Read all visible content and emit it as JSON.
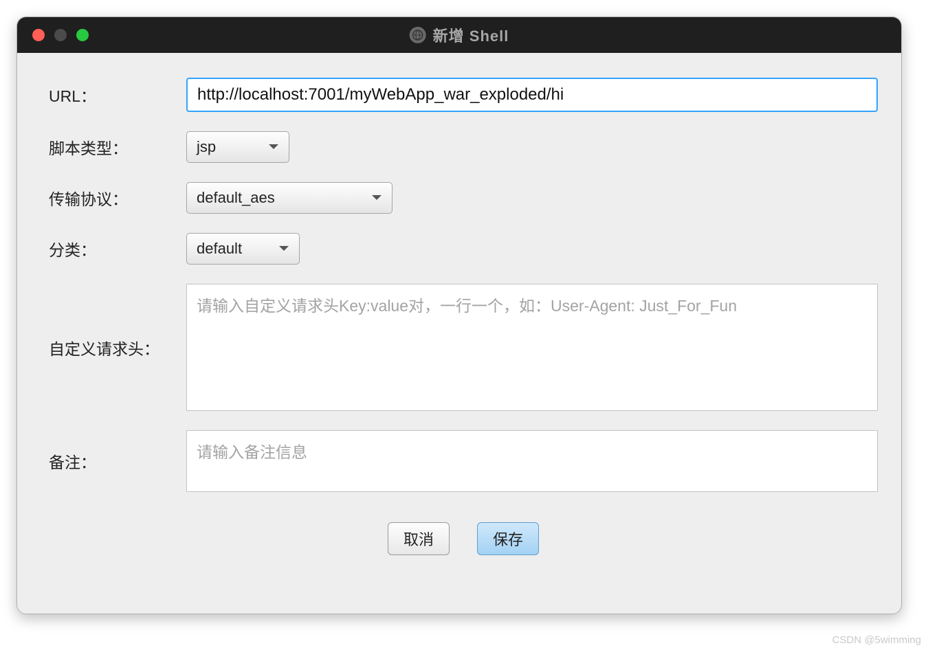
{
  "window": {
    "title": "新增 Shell"
  },
  "form": {
    "url": {
      "label": "URL：",
      "value": "http://localhost:7001/myWebApp_war_exploded/hi"
    },
    "scriptType": {
      "label": "脚本类型：",
      "selected": "jsp"
    },
    "protocol": {
      "label": "传输协议：",
      "selected": "default_aes"
    },
    "category": {
      "label": "分类：",
      "selected": "default"
    },
    "customHeaders": {
      "label": "自定义请求头：",
      "placeholder": "请输入自定义请求头Key:value对，一行一个，如：User-Agent: Just_For_Fun"
    },
    "remark": {
      "label": "备注：",
      "placeholder": "请输入备注信息"
    }
  },
  "buttons": {
    "cancel": "取消",
    "save": "保存"
  },
  "watermark": "CSDN @5wimming"
}
